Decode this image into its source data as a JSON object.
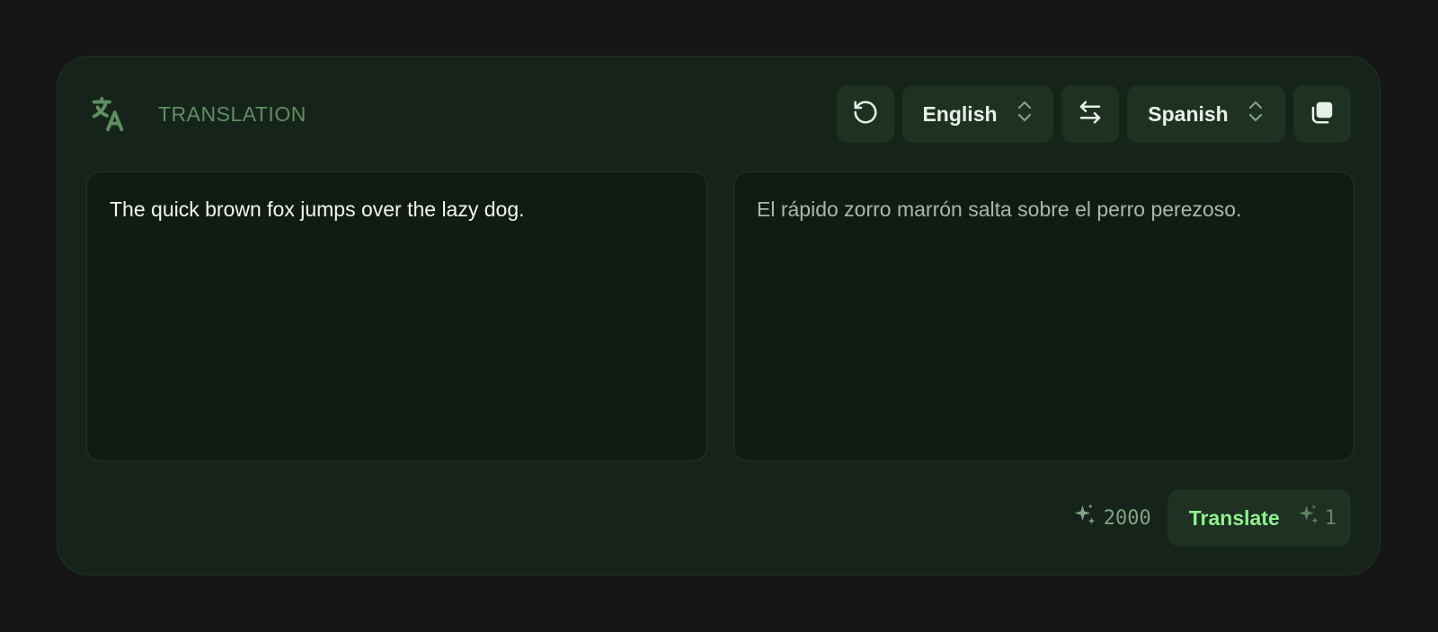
{
  "header": {
    "title": "TRANSLATION",
    "icons": {
      "brand": "translate-icon",
      "reset": "rotate-ccw-icon",
      "swap": "arrows-left-right-icon",
      "copy": "copy-icon"
    },
    "source_language": "English",
    "target_language": "Spanish"
  },
  "source": {
    "text": "The quick brown fox jumps over the lazy dog."
  },
  "result": {
    "text": "El rápido zorro marrón salta sobre el perro perezoso."
  },
  "footer": {
    "credits": "2000",
    "translate_label": "Translate",
    "cost": "1"
  },
  "colors": {
    "background": "#151515",
    "card": "#16231a",
    "accent": "#8ff08f",
    "muted": "#5d8f61"
  }
}
